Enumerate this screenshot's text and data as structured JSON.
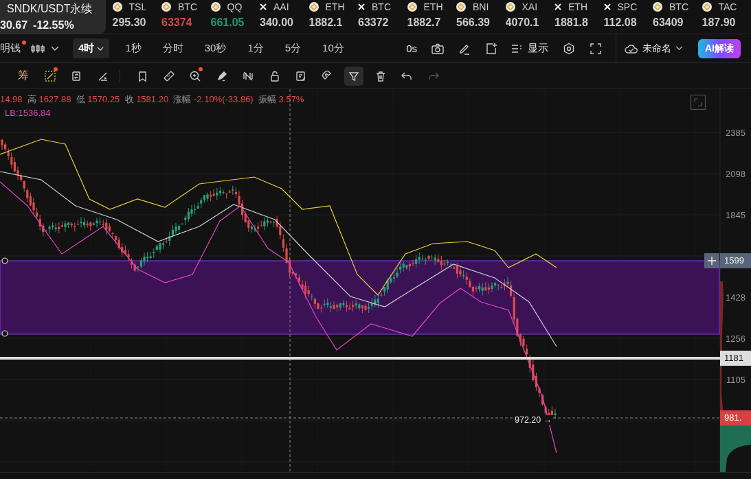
{
  "symbol": {
    "name": "SNDK/USDT永续",
    "price": "30.67",
    "change": "-12.55%"
  },
  "tickers": [
    {
      "kind": "coin",
      "name": "TSL",
      "value": "295.30",
      "color": "#cccccc"
    },
    {
      "kind": "coin",
      "name": "BTC",
      "value": "63374",
      "color": "#d04848"
    },
    {
      "kind": "coin",
      "name": "QQ",
      "value": "661.05",
      "color": "#1f9a6e"
    },
    {
      "kind": "cross",
      "name": "AAI",
      "value": "340.00",
      "color": "#cccccc"
    },
    {
      "kind": "coin",
      "name": "ETH",
      "value": "1882.1",
      "color": "#cccccc"
    },
    {
      "kind": "cross",
      "name": "BTC",
      "value": "63372",
      "color": "#cccccc"
    },
    {
      "kind": "coin",
      "name": "ETH",
      "value": "1882.7",
      "color": "#cccccc"
    },
    {
      "kind": "coin",
      "name": "BNI",
      "value": "566.39",
      "color": "#cccccc"
    },
    {
      "kind": "coin",
      "name": "XAI",
      "value": "4070.1",
      "color": "#cccccc"
    },
    {
      "kind": "cross",
      "name": "ETH",
      "value": "1881.8",
      "color": "#cccccc"
    },
    {
      "kind": "cross",
      "name": "SPC",
      "value": "112.08",
      "color": "#cccccc"
    },
    {
      "kind": "coin",
      "name": "BTC",
      "value": "63409",
      "color": "#cccccc"
    },
    {
      "kind": "coin",
      "name": "TAC",
      "value": "187.90",
      "color": "#cccccc"
    }
  ],
  "indicator_menu": {
    "label": "明钱",
    "badge": true
  },
  "intervals": [
    {
      "label": "4时",
      "selected": true,
      "dropdown": true
    },
    {
      "label": "1秒",
      "selected": false
    },
    {
      "label": "分时",
      "selected": false
    },
    {
      "label": "30秒",
      "selected": false
    },
    {
      "label": "1分",
      "selected": false
    },
    {
      "label": "5分",
      "selected": false
    },
    {
      "label": "10分",
      "selected": false
    }
  ],
  "timer": "0s",
  "display_menu": "显示",
  "layout_menu": "未命名",
  "ai_button": "AI解读",
  "tools": [
    {
      "kind": "text",
      "label": "筹",
      "badge": false,
      "selected": false,
      "disabled": false
    },
    {
      "kind": "dashed-box",
      "badge": true,
      "selected": false,
      "disabled": false
    },
    {
      "kind": "sync",
      "badge": false,
      "selected": false,
      "disabled": false
    },
    {
      "kind": "ruler-slant",
      "badge": false,
      "selected": false,
      "disabled": false
    },
    {
      "kind": "divider"
    },
    {
      "kind": "bookmark",
      "badge": false,
      "selected": false,
      "disabled": false
    },
    {
      "kind": "ruler",
      "badge": false,
      "selected": false,
      "disabled": false
    },
    {
      "kind": "zoom",
      "badge": true,
      "selected": false,
      "disabled": false
    },
    {
      "kind": "pen",
      "badge": false,
      "selected": false,
      "disabled": false
    },
    {
      "kind": "hide",
      "badge": false,
      "selected": false,
      "disabled": false
    },
    {
      "kind": "lock",
      "badge": false,
      "selected": false,
      "disabled": false
    },
    {
      "kind": "note",
      "badge": false,
      "selected": false,
      "disabled": false
    },
    {
      "kind": "magnet",
      "badge": false,
      "selected": false,
      "disabled": false
    },
    {
      "kind": "filter",
      "badge": false,
      "selected": true,
      "disabled": false
    },
    {
      "kind": "trash",
      "badge": false,
      "selected": false,
      "disabled": false
    },
    {
      "kind": "undo",
      "badge": false,
      "selected": false,
      "disabled": false
    },
    {
      "kind": "redo",
      "badge": false,
      "selected": false,
      "disabled": true
    }
  ],
  "ohlc": [
    {
      "value": "14.98"
    },
    {
      "label": "高",
      "value": "1627.88"
    },
    {
      "label": "低",
      "value": "1570.25"
    },
    {
      "label": "收",
      "value": "1581.20"
    },
    {
      "label": "涨幅",
      "value": "-2.10%(-33.86)"
    },
    {
      "label": "振幅",
      "value": "3.57%"
    }
  ],
  "indicator_value": "LB:1536.84",
  "price_axis": [
    "2385",
    "2098",
    "1845",
    "1428",
    "1256",
    "1105"
  ],
  "price_tags": [
    {
      "kind": "zone",
      "text": "1599"
    },
    {
      "kind": "line",
      "text": "1181"
    },
    {
      "kind": "last",
      "text": "981."
    }
  ],
  "low_marker": {
    "value": "972.20",
    "arrow": "→"
  }
}
